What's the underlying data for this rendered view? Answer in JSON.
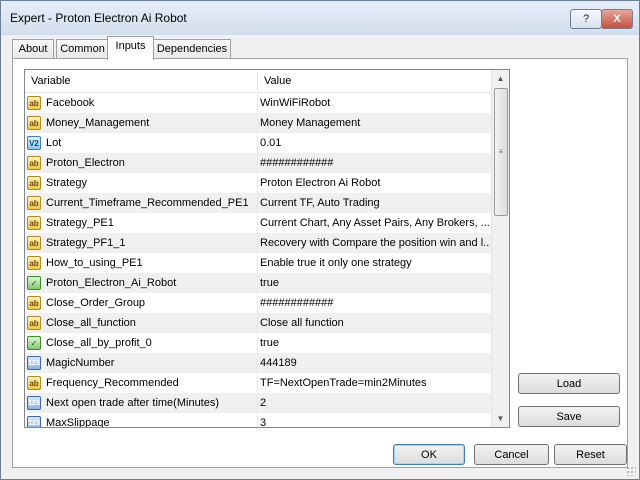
{
  "window": {
    "title": "Expert - Proton Electron Ai Robot",
    "help_label": "?",
    "close_label": "X"
  },
  "tabs": [
    {
      "label": "About"
    },
    {
      "label": "Common"
    },
    {
      "label": "Inputs",
      "active": true
    },
    {
      "label": "Dependencies"
    }
  ],
  "table": {
    "columns": [
      "Variable",
      "Value"
    ],
    "rows": [
      {
        "icon": "string-icon",
        "glyph": "ab",
        "variable": "Facebook",
        "value": "WinWiFiRobot"
      },
      {
        "icon": "string-icon",
        "glyph": "ab",
        "variable": "Money_Management",
        "value": "Money Management"
      },
      {
        "icon": "double-icon",
        "glyph": "V2",
        "variable": "Lot",
        "value": "0.01"
      },
      {
        "icon": "string-icon",
        "glyph": "ab",
        "variable": "Proton_Electron",
        "value": "############"
      },
      {
        "icon": "string-icon",
        "glyph": "ab",
        "variable": "Strategy",
        "value": "Proton Electron Ai Robot"
      },
      {
        "icon": "string-icon",
        "glyph": "ab",
        "variable": "Current_Timeframe_Recommended_PE1",
        "value": "Current TF, Auto Trading"
      },
      {
        "icon": "string-icon",
        "glyph": "ab",
        "variable": "Strategy_PE1",
        "value": "Current Chart, Any Asset Pairs, Any Brokers, ..."
      },
      {
        "icon": "string-icon",
        "glyph": "ab",
        "variable": "Strategy_PF1_1",
        "value": "Recovery with Compare the position win and l..."
      },
      {
        "icon": "string-icon",
        "glyph": "ab",
        "variable": "How_to_using_PE1",
        "value": "Enable true it only one strategy"
      },
      {
        "icon": "bool-icon",
        "glyph": "✓",
        "variable": "Proton_Electron_Ai_Robot",
        "value": "true"
      },
      {
        "icon": "string-icon",
        "glyph": "ab",
        "variable": "Close_Order_Group",
        "value": "############"
      },
      {
        "icon": "string-icon",
        "glyph": "ab",
        "variable": "Close_all_function",
        "value": "Close all function"
      },
      {
        "icon": "bool-icon",
        "glyph": "✓",
        "variable": "Close_all_by_profit_0",
        "value": "true"
      },
      {
        "icon": "integer-icon",
        "glyph": "123",
        "variable": "MagicNumber",
        "value": "444189"
      },
      {
        "icon": "string-icon",
        "glyph": "ab",
        "variable": "Frequency_Recommended",
        "value": "TF=NextOpenTrade=min2Minutes"
      },
      {
        "icon": "integer-icon",
        "glyph": "123",
        "variable": "Next open trade after time(Minutes)",
        "value": "2"
      },
      {
        "icon": "integer-icon",
        "glyph": "123",
        "variable": "MaxSlippage",
        "value": "3"
      }
    ]
  },
  "side_buttons": {
    "load": "Load",
    "save": "Save"
  },
  "footer_buttons": {
    "ok": "OK",
    "cancel": "Cancel",
    "reset": "Reset"
  },
  "scrollbar": {
    "up_glyph": "▲",
    "down_glyph": "▼",
    "thumb_glyph": "≡"
  }
}
